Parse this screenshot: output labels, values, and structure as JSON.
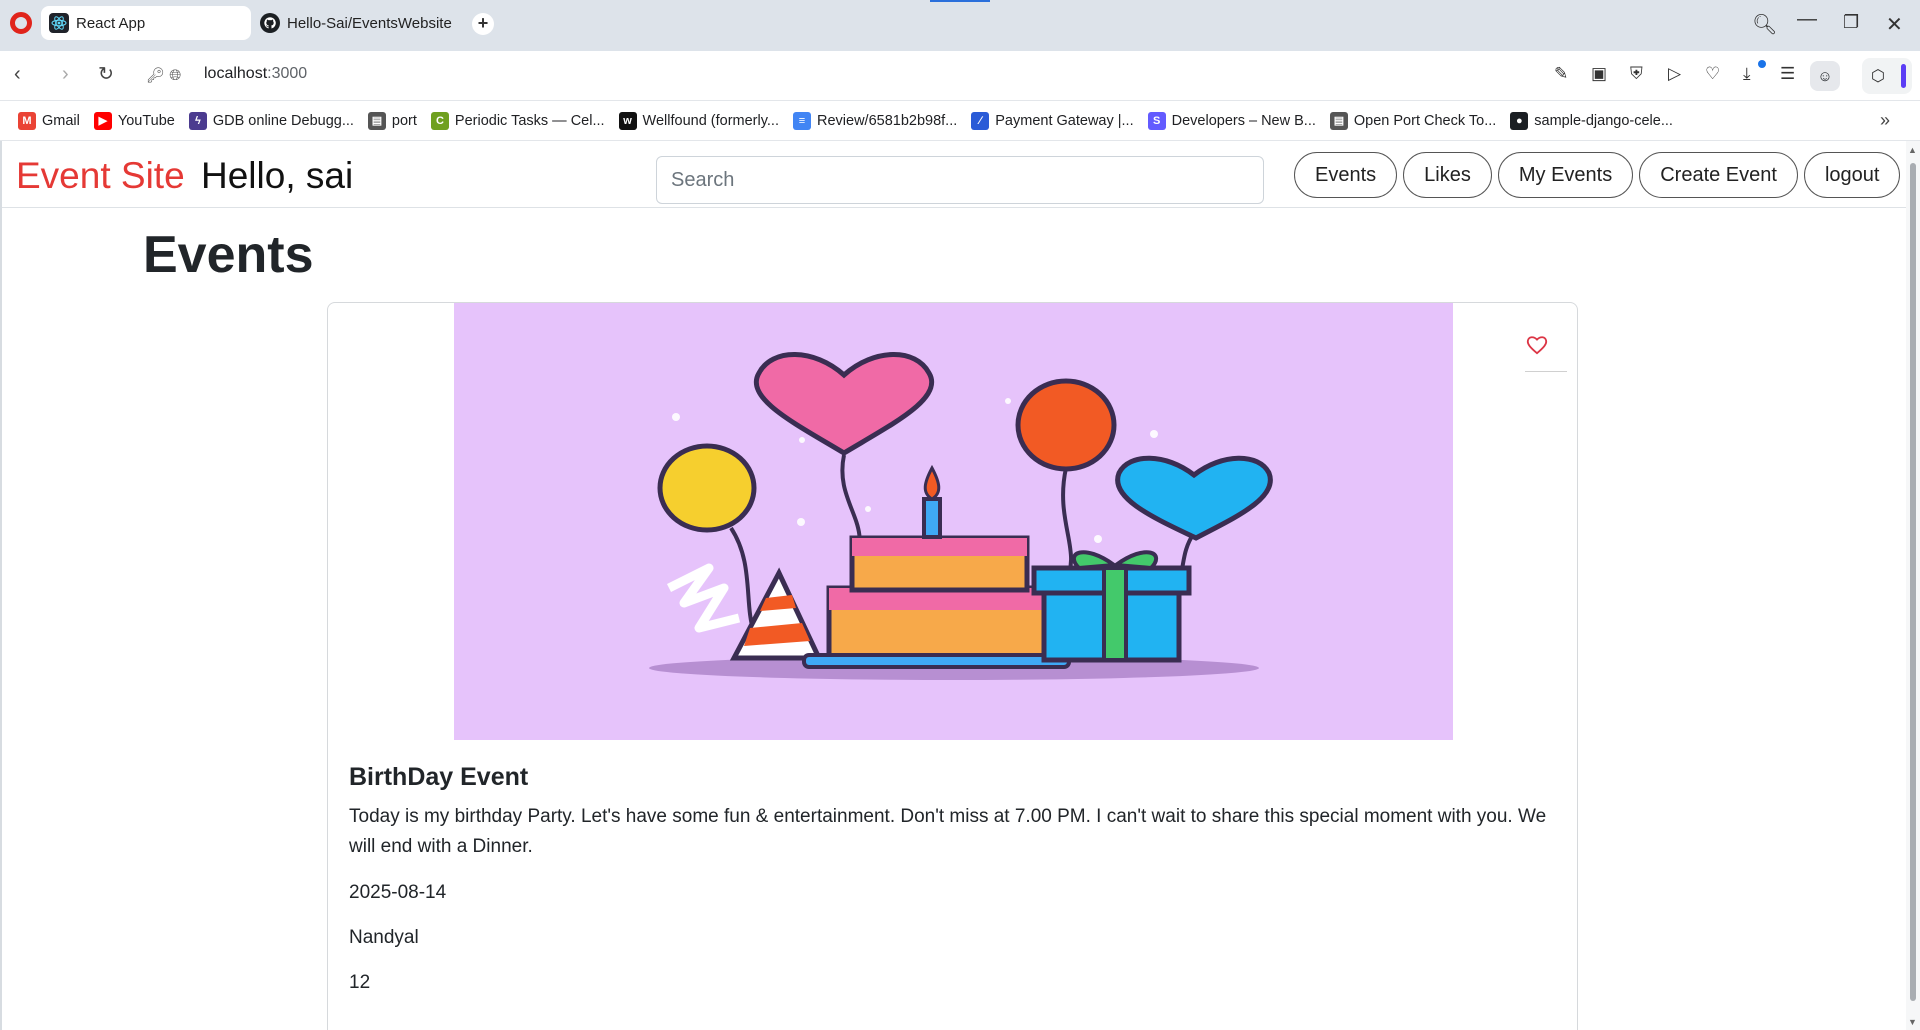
{
  "browser": {
    "tabs": [
      {
        "title": "React App",
        "active": true,
        "icon": "react-icon"
      },
      {
        "title": "Hello-Sai/EventsWebsite",
        "active": false,
        "icon": "github-icon"
      }
    ],
    "url_host": "localhost",
    "url_port": ":3000",
    "bookmarks": [
      {
        "label": "Gmail",
        "icon": "gmail-icon",
        "color": "#ea4335"
      },
      {
        "label": "YouTube",
        "icon": "youtube-icon",
        "color": "#ff0000"
      },
      {
        "label": "GDB online Debugg...",
        "icon": "gdb-icon",
        "color": "#4b3b8f"
      },
      {
        "label": "port",
        "icon": "page-icon",
        "color": "#555555"
      },
      {
        "label": "Periodic Tasks — Cel...",
        "icon": "celery-icon",
        "color": "#6fa01f"
      },
      {
        "label": "Wellfound (formerly...",
        "icon": "wellfound-icon",
        "color": "#111111"
      },
      {
        "label": "Review/6581b2b98f...",
        "icon": "docs-icon",
        "color": "#4285f4"
      },
      {
        "label": "Payment Gateway |...",
        "icon": "payment-icon",
        "color": "#2a5bd7"
      },
      {
        "label": "Developers – New B...",
        "icon": "stripe-icon",
        "color": "#635bff"
      },
      {
        "label": "Open Port Check To...",
        "icon": "page-icon",
        "color": "#555555"
      },
      {
        "label": "sample-django-cele...",
        "icon": "github-icon",
        "color": "#1b1f23"
      }
    ]
  },
  "app": {
    "brand": "Event Site",
    "greeting": "Hello, sai",
    "search_placeholder": "Search",
    "nav": [
      "Events",
      "Likes",
      "My Events",
      "Create Event",
      "logout"
    ]
  },
  "main": {
    "title": "Events",
    "event": {
      "title": "BirthDay Event",
      "description": "Today is my birthday Party. Let's have some fun & entertainment. Don't miss at 7.00 PM. I can't wait to share this special moment with you. We will end with a Dinner.",
      "date": "2025-08-14",
      "location": "Nandyal",
      "count": "12",
      "liked": false,
      "image_bg": "#e6c3fb"
    }
  }
}
